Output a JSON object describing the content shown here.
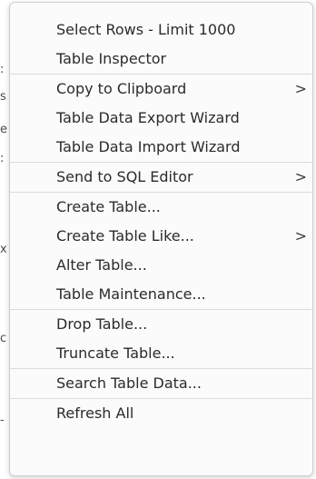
{
  "background_fragments": [
    ":",
    "s",
    "e",
    ":",
    "x",
    "c",
    "-"
  ],
  "menu": {
    "groups": [
      [
        {
          "label": "Select Rows - Limit 1000",
          "submenu": false
        },
        {
          "label": "Table Inspector",
          "submenu": false
        }
      ],
      [
        {
          "label": "Copy to Clipboard",
          "submenu": true
        },
        {
          "label": "Table Data Export Wizard",
          "submenu": false
        },
        {
          "label": "Table Data Import Wizard",
          "submenu": false
        }
      ],
      [
        {
          "label": "Send to SQL Editor",
          "submenu": true
        }
      ],
      [
        {
          "label": "Create Table...",
          "submenu": false
        },
        {
          "label": "Create Table Like...",
          "submenu": true
        },
        {
          "label": "Alter Table...",
          "submenu": false
        },
        {
          "label": "Table Maintenance...",
          "submenu": false
        }
      ],
      [
        {
          "label": "Drop Table...",
          "submenu": false
        },
        {
          "label": "Truncate Table...",
          "submenu": false
        }
      ],
      [
        {
          "label": "Search Table Data...",
          "submenu": false
        }
      ],
      [
        {
          "label": "Refresh All",
          "submenu": false
        }
      ]
    ],
    "submenu_arrow": ">"
  }
}
